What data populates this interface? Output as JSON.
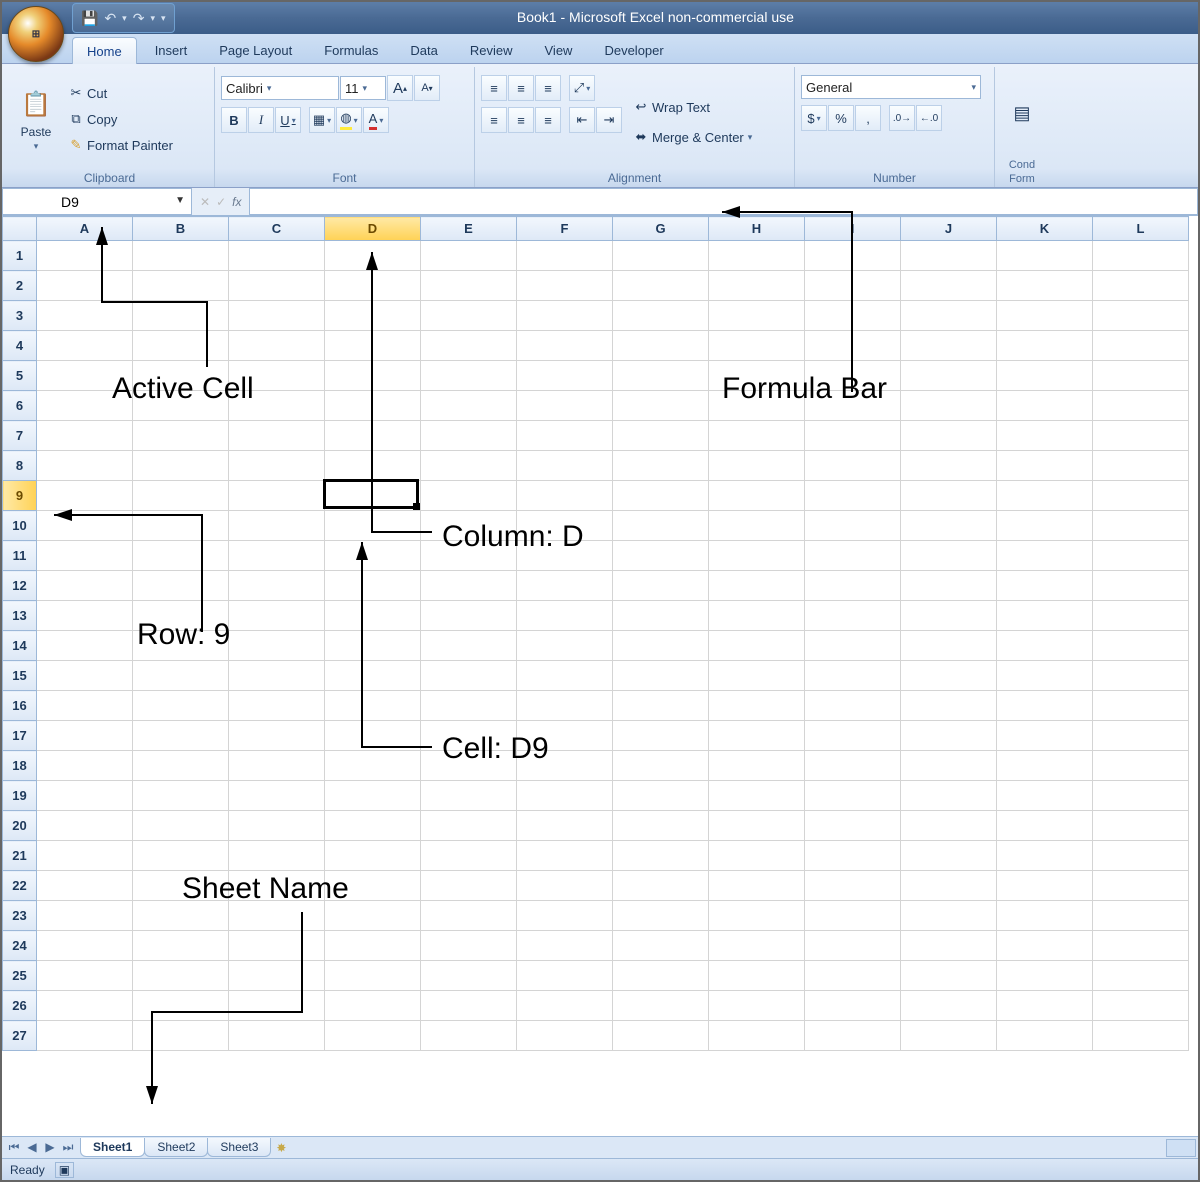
{
  "title": "Book1 - Microsoft Excel non-commercial use",
  "qat": {
    "save_icon": "💾",
    "undo_icon": "↶",
    "redo_icon": "↷",
    "custom_icon": "▾"
  },
  "tabs": [
    "Home",
    "Insert",
    "Page Layout",
    "Formulas",
    "Data",
    "Review",
    "View",
    "Developer"
  ],
  "active_tab": 0,
  "clipboard": {
    "paste": "Paste",
    "cut": "Cut",
    "copy": "Copy",
    "format_painter": "Format Painter",
    "group": "Clipboard"
  },
  "font": {
    "family": "Calibri",
    "size": "11",
    "increase": "A",
    "decrease": "A",
    "bold": "B",
    "italic": "I",
    "underline": "U",
    "group": "Font"
  },
  "alignment": {
    "wrap": "Wrap Text",
    "merge": "Merge & Center",
    "group": "Alignment"
  },
  "number": {
    "format": "General",
    "currency": "$",
    "percent": "%",
    "comma": ",",
    "inc_dec": "←.0",
    "dec_dec": ".0→",
    "group": "Number"
  },
  "styles_cut": {
    "cond": "Cond",
    "format": "Form"
  },
  "name_box": "D9",
  "fx": "fx",
  "columns": [
    "A",
    "B",
    "C",
    "D",
    "E",
    "F",
    "G",
    "H",
    "I",
    "J",
    "K",
    "L"
  ],
  "active_col_index": 3,
  "rows": 27,
  "active_row": 9,
  "sheets": [
    "Sheet1",
    "Sheet2",
    "Sheet3"
  ],
  "active_sheet": 0,
  "status": "Ready",
  "annotations": {
    "active_cell": "Active Cell",
    "formula_bar": "Formula Bar",
    "column": "Column: D",
    "row": "Row: 9",
    "cell": "Cell: D9",
    "sheet_name": "Sheet Name"
  }
}
